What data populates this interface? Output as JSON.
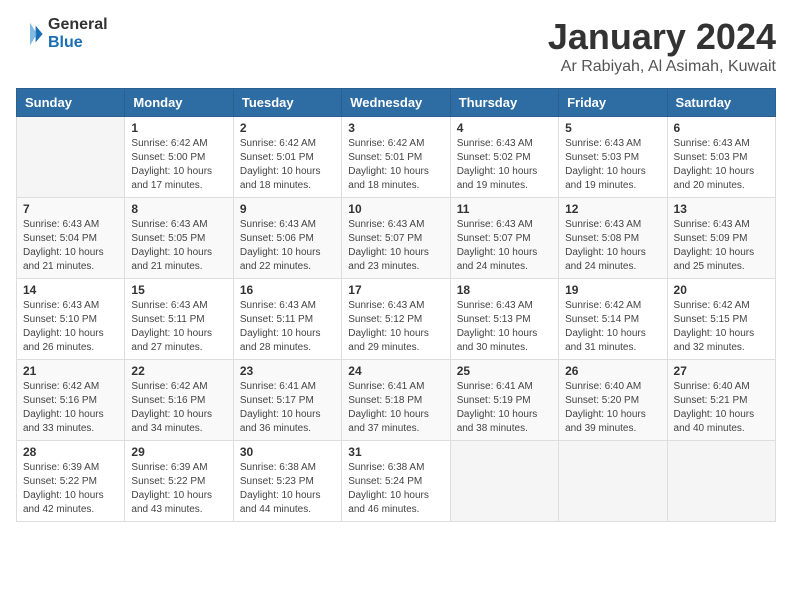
{
  "header": {
    "logo_general": "General",
    "logo_blue": "Blue",
    "month": "January 2024",
    "location": "Ar Rabiyah, Al Asimah, Kuwait"
  },
  "weekdays": [
    "Sunday",
    "Monday",
    "Tuesday",
    "Wednesday",
    "Thursday",
    "Friday",
    "Saturday"
  ],
  "weeks": [
    [
      null,
      {
        "day": 1,
        "sunrise": "6:42 AM",
        "sunset": "5:00 PM",
        "daylight": "10 hours and 17 minutes."
      },
      {
        "day": 2,
        "sunrise": "6:42 AM",
        "sunset": "5:01 PM",
        "daylight": "10 hours and 18 minutes."
      },
      {
        "day": 3,
        "sunrise": "6:42 AM",
        "sunset": "5:01 PM",
        "daylight": "10 hours and 18 minutes."
      },
      {
        "day": 4,
        "sunrise": "6:43 AM",
        "sunset": "5:02 PM",
        "daylight": "10 hours and 19 minutes."
      },
      {
        "day": 5,
        "sunrise": "6:43 AM",
        "sunset": "5:03 PM",
        "daylight": "10 hours and 19 minutes."
      },
      {
        "day": 6,
        "sunrise": "6:43 AM",
        "sunset": "5:03 PM",
        "daylight": "10 hours and 20 minutes."
      }
    ],
    [
      {
        "day": 7,
        "sunrise": "6:43 AM",
        "sunset": "5:04 PM",
        "daylight": "10 hours and 21 minutes."
      },
      {
        "day": 8,
        "sunrise": "6:43 AM",
        "sunset": "5:05 PM",
        "daylight": "10 hours and 21 minutes."
      },
      {
        "day": 9,
        "sunrise": "6:43 AM",
        "sunset": "5:06 PM",
        "daylight": "10 hours and 22 minutes."
      },
      {
        "day": 10,
        "sunrise": "6:43 AM",
        "sunset": "5:07 PM",
        "daylight": "10 hours and 23 minutes."
      },
      {
        "day": 11,
        "sunrise": "6:43 AM",
        "sunset": "5:07 PM",
        "daylight": "10 hours and 24 minutes."
      },
      {
        "day": 12,
        "sunrise": "6:43 AM",
        "sunset": "5:08 PM",
        "daylight": "10 hours and 24 minutes."
      },
      {
        "day": 13,
        "sunrise": "6:43 AM",
        "sunset": "5:09 PM",
        "daylight": "10 hours and 25 minutes."
      }
    ],
    [
      {
        "day": 14,
        "sunrise": "6:43 AM",
        "sunset": "5:10 PM",
        "daylight": "10 hours and 26 minutes."
      },
      {
        "day": 15,
        "sunrise": "6:43 AM",
        "sunset": "5:11 PM",
        "daylight": "10 hours and 27 minutes."
      },
      {
        "day": 16,
        "sunrise": "6:43 AM",
        "sunset": "5:11 PM",
        "daylight": "10 hours and 28 minutes."
      },
      {
        "day": 17,
        "sunrise": "6:43 AM",
        "sunset": "5:12 PM",
        "daylight": "10 hours and 29 minutes."
      },
      {
        "day": 18,
        "sunrise": "6:43 AM",
        "sunset": "5:13 PM",
        "daylight": "10 hours and 30 minutes."
      },
      {
        "day": 19,
        "sunrise": "6:42 AM",
        "sunset": "5:14 PM",
        "daylight": "10 hours and 31 minutes."
      },
      {
        "day": 20,
        "sunrise": "6:42 AM",
        "sunset": "5:15 PM",
        "daylight": "10 hours and 32 minutes."
      }
    ],
    [
      {
        "day": 21,
        "sunrise": "6:42 AM",
        "sunset": "5:16 PM",
        "daylight": "10 hours and 33 minutes."
      },
      {
        "day": 22,
        "sunrise": "6:42 AM",
        "sunset": "5:16 PM",
        "daylight": "10 hours and 34 minutes."
      },
      {
        "day": 23,
        "sunrise": "6:41 AM",
        "sunset": "5:17 PM",
        "daylight": "10 hours and 36 minutes."
      },
      {
        "day": 24,
        "sunrise": "6:41 AM",
        "sunset": "5:18 PM",
        "daylight": "10 hours and 37 minutes."
      },
      {
        "day": 25,
        "sunrise": "6:41 AM",
        "sunset": "5:19 PM",
        "daylight": "10 hours and 38 minutes."
      },
      {
        "day": 26,
        "sunrise": "6:40 AM",
        "sunset": "5:20 PM",
        "daylight": "10 hours and 39 minutes."
      },
      {
        "day": 27,
        "sunrise": "6:40 AM",
        "sunset": "5:21 PM",
        "daylight": "10 hours and 40 minutes."
      }
    ],
    [
      {
        "day": 28,
        "sunrise": "6:39 AM",
        "sunset": "5:22 PM",
        "daylight": "10 hours and 42 minutes."
      },
      {
        "day": 29,
        "sunrise": "6:39 AM",
        "sunset": "5:22 PM",
        "daylight": "10 hours and 43 minutes."
      },
      {
        "day": 30,
        "sunrise": "6:38 AM",
        "sunset": "5:23 PM",
        "daylight": "10 hours and 44 minutes."
      },
      {
        "day": 31,
        "sunrise": "6:38 AM",
        "sunset": "5:24 PM",
        "daylight": "10 hours and 46 minutes."
      },
      null,
      null,
      null
    ]
  ]
}
